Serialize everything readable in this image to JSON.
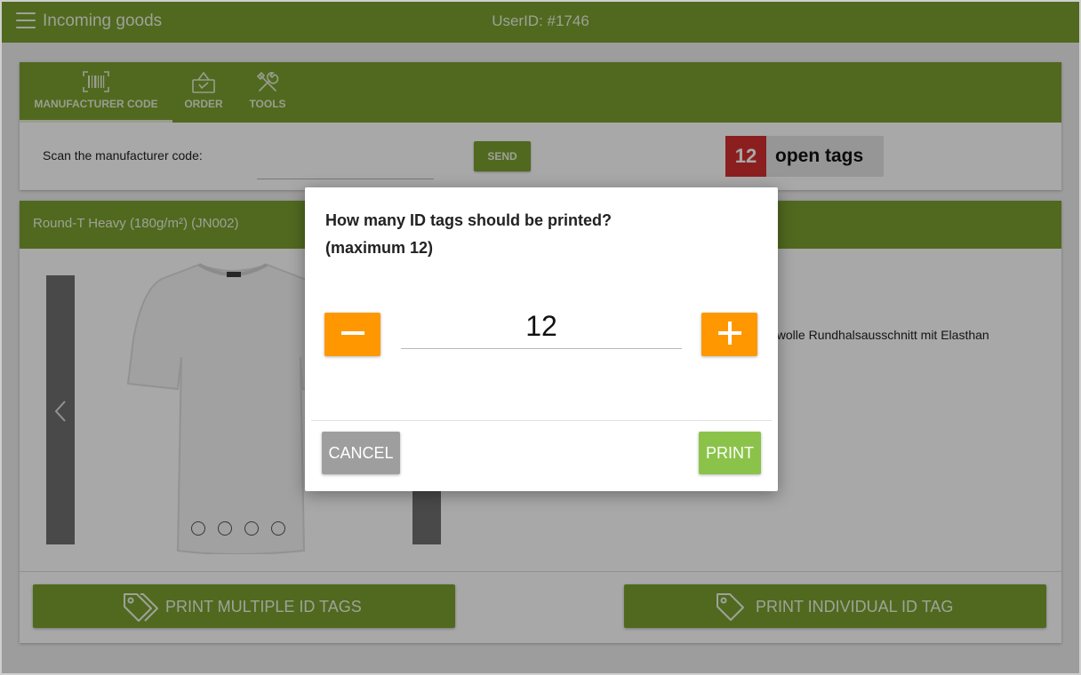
{
  "colors": {
    "primary": "#7aa02f",
    "accent": "#ff9800",
    "danger": "#d32f2f",
    "print": "#8bc34a",
    "cancel": "#9e9e9e"
  },
  "header": {
    "menu_icon": "hamburger-menu-icon",
    "title": "Incoming goods",
    "user_id": "UserID: #1746"
  },
  "tabs": [
    {
      "icon": "barcode-icon",
      "label": "MANUFACTURER CODE",
      "active": true
    },
    {
      "icon": "shopping-basket-icon",
      "label": "ORDER",
      "active": false
    },
    {
      "icon": "tools-icon",
      "label": "TOOLS",
      "active": false
    }
  ],
  "scan": {
    "label": "Scan the manufacturer code:",
    "value": "",
    "send_label": "SEND"
  },
  "open_tags": {
    "count": "12",
    "label": "open tags"
  },
  "product": {
    "title": "Round-T Heavy (180g/m²) (JN002)",
    "description": "nwolle Rundhalsausschnitt mit Elasthan",
    "image_count": 4
  },
  "actions": {
    "print_multiple": {
      "icon": "tags-icon",
      "label": "PRINT MULTIPLE ID TAGS"
    },
    "print_individual": {
      "icon": "tag-icon",
      "label": "PRINT INDIVIDUAL ID TAG"
    }
  },
  "dialog": {
    "question": "How many ID tags should be printed?",
    "maximum": "(maximum 12)",
    "quantity": "12",
    "cancel_label": "CANCEL",
    "print_label": "PRINT"
  }
}
